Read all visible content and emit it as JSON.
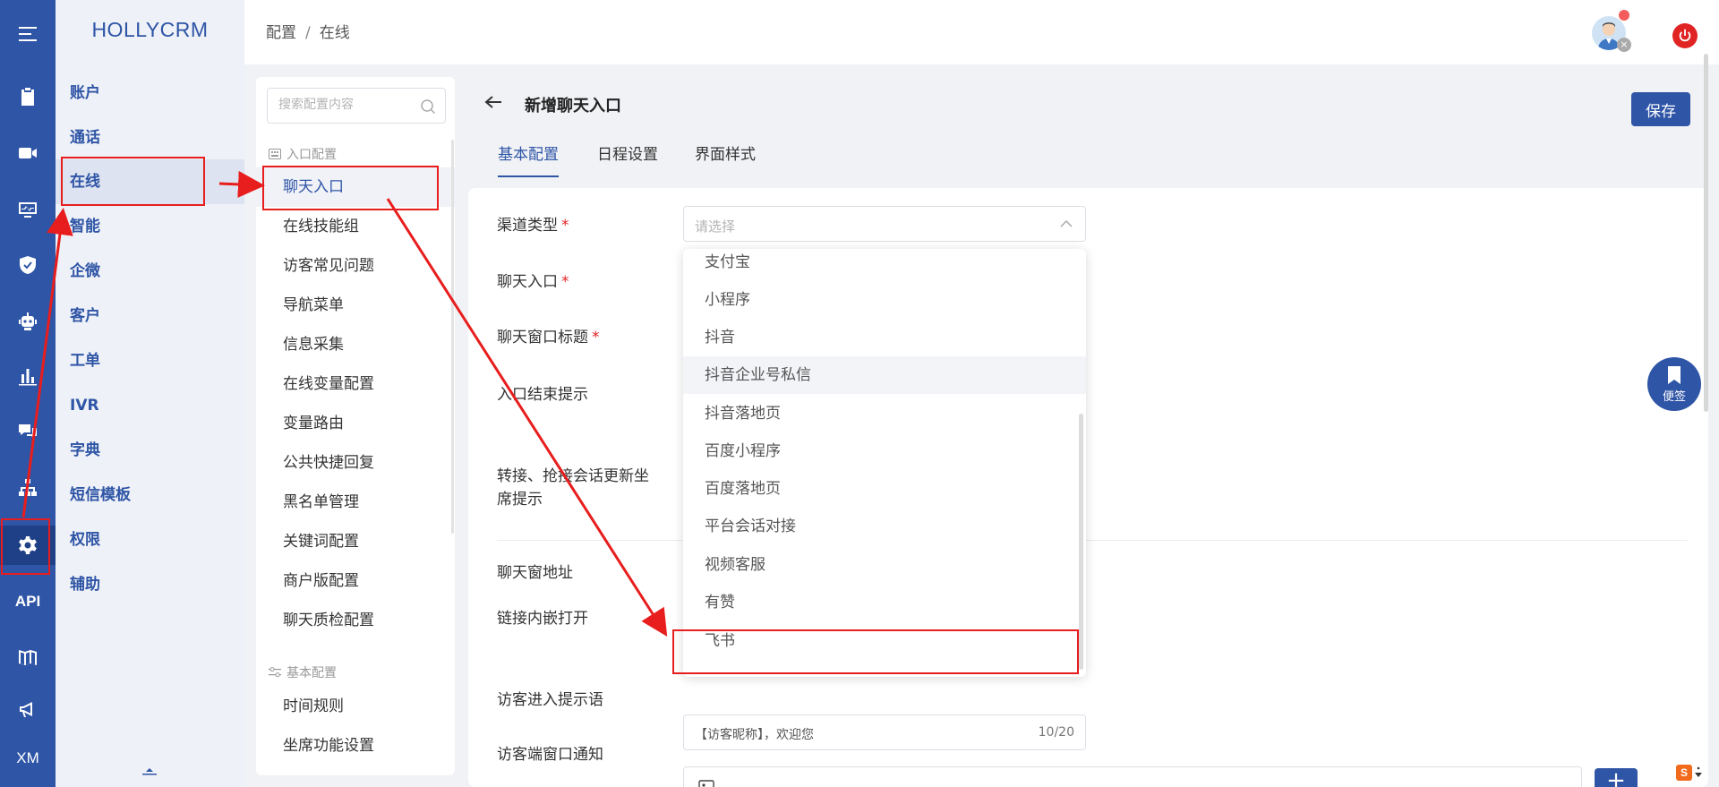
{
  "app": {
    "logo": "HOLLYCRM"
  },
  "rail": {
    "icons": [
      "menu-icon",
      "clipboard-icon",
      "video-icon",
      "monitor-icon",
      "shield-icon",
      "robot-icon",
      "bar-chart-icon",
      "chat-icon",
      "org-chart-icon",
      "gear-icon",
      "api-icon",
      "book-icon",
      "megaphone-icon",
      "xm-icon"
    ],
    "api_label": "API",
    "xm_label": "XM"
  },
  "menu": {
    "items": [
      "账户",
      "通话",
      "在线",
      "智能",
      "企微",
      "客户",
      "工单",
      "IVR",
      "字典",
      "短信模板",
      "权限",
      "辅助"
    ],
    "active": "在线"
  },
  "header": {
    "breadcrumb": [
      "配置",
      "在线"
    ],
    "separator": "/"
  },
  "subpanel": {
    "search_placeholder": "搜索配置内容",
    "group1": "入口配置",
    "group1_items": [
      "聊天入口",
      "在线技能组",
      "访客常见问题",
      "导航菜单",
      "信息采集",
      "在线变量配置",
      "变量路由",
      "公共快捷回复",
      "黑名单管理",
      "关键词配置",
      "商户版配置",
      "聊天质检配置"
    ],
    "group2": "基本配置",
    "group2_items": [
      "时间规则",
      "坐席功能设置"
    ]
  },
  "page": {
    "title": "新增聊天入口",
    "save_label": "保存",
    "tabs": [
      "基本配置",
      "日程设置",
      "界面样式"
    ],
    "active_tab": "基本配置"
  },
  "form": {
    "labels": [
      "渠道类型",
      "聊天入口",
      "聊天窗口标题",
      "入口结束提示",
      "转接、抢接会话更新坐",
      "席提示",
      "聊天窗地址",
      "链接内嵌打开",
      "访客进入提示语",
      "访客端窗口通知"
    ],
    "required_mark": "*",
    "channel_placeholder": "请选择",
    "channel_options": [
      "支付宝",
      "小程序",
      "抖音",
      "抖音企业号私信",
      "抖音落地页",
      "百度小程序",
      "百度落地页",
      "平台会话对接",
      "视频客服",
      "有赞",
      "飞书"
    ],
    "hovered_option": "抖音企业号私信",
    "welcome_value": "【访客昵称】，欢迎您",
    "welcome_count": "10/20",
    "add_label": "+"
  },
  "widgets": {
    "sticky_note": "便签",
    "ime_label": "S"
  },
  "colors": {
    "brand": "#2f55a6",
    "annotation": "#e81d1d",
    "power": "#e02424"
  }
}
